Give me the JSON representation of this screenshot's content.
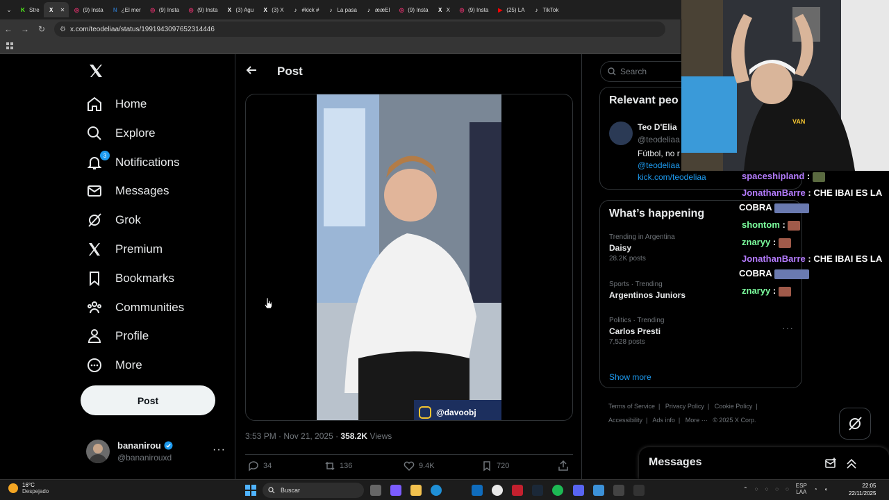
{
  "browser": {
    "tabs": [
      {
        "label": "Stre",
        "icon_color": "#53fc18",
        "icon": "K"
      },
      {
        "label": "",
        "icon_color": "#ffffff",
        "icon": "X",
        "active": true
      },
      {
        "label": "(9) Insta",
        "icon_color": "#e1306c",
        "icon": "◎"
      },
      {
        "label": "¿El mer",
        "icon_color": "#2b6cb0",
        "icon": "N"
      },
      {
        "label": "(9) Insta",
        "icon_color": "#e1306c",
        "icon": "◎"
      },
      {
        "label": "(9) Insta",
        "icon_color": "#e1306c",
        "icon": "◎"
      },
      {
        "label": "(3) Agu",
        "icon_color": "#ffffff",
        "icon": "X"
      },
      {
        "label": "(3) X",
        "icon_color": "#ffffff",
        "icon": "X"
      },
      {
        "label": "#kick #",
        "icon_color": "#ffffff",
        "icon": "♪"
      },
      {
        "label": "La pasa",
        "icon_color": "#ffffff",
        "icon": "♪"
      },
      {
        "label": "ææEl",
        "icon_color": "#ffffff",
        "icon": "♪"
      },
      {
        "label": "(9) Insta",
        "icon_color": "#e1306c",
        "icon": "◎"
      },
      {
        "label": "X",
        "icon_color": "#ffffff",
        "icon": "X"
      },
      {
        "label": "(9) Insta",
        "icon_color": "#e1306c",
        "icon": "◎"
      },
      {
        "label": "(25) LA",
        "icon_color": "#ff0000",
        "icon": "▶"
      },
      {
        "label": "TikTok",
        "icon_color": "#ffffff",
        "icon": "♪"
      }
    ],
    "url": "x.com/teodeliaa/status/1991943097652314446"
  },
  "nav": {
    "items": [
      {
        "label": "Home",
        "icon": "home-icon"
      },
      {
        "label": "Explore",
        "icon": "search-icon"
      },
      {
        "label": "Notifications",
        "icon": "bell-icon",
        "badge": "3"
      },
      {
        "label": "Messages",
        "icon": "envelope-icon"
      },
      {
        "label": "Grok",
        "icon": "grok-icon"
      },
      {
        "label": "Premium",
        "icon": "x-icon"
      },
      {
        "label": "Bookmarks",
        "icon": "bookmark-icon"
      },
      {
        "label": "Communities",
        "icon": "people-icon"
      },
      {
        "label": "Profile",
        "icon": "person-icon"
      },
      {
        "label": "More",
        "icon": "more-circle-icon"
      }
    ],
    "post_button": "Post",
    "account": {
      "name": "bananirou",
      "handle": "@bananirouxd"
    }
  },
  "post": {
    "header_title": "Post",
    "video_watermark": "@davoobj",
    "timestamp": "3:53 PM · Nov 21, 2025 · ",
    "views_count": "358.2K",
    "views_label": " Views",
    "actions": {
      "replies": "34",
      "reposts": "136",
      "likes": "9.4K",
      "bookmarks": "720"
    }
  },
  "sidebar": {
    "search_placeholder": "Search",
    "relevant": {
      "title": "Relevant peo",
      "name": "Teo D'Elia",
      "handle": "@teodeliaa",
      "bio": "Fútbol, no r",
      "link1": "@teodeliaa",
      "link2": "kick.com/teodeliaa"
    },
    "happening": {
      "title": "What’s happening",
      "trends": [
        {
          "context": "Trending in Argentina",
          "title": "Daisy",
          "posts": "28.2K posts"
        },
        {
          "context": "Sports · Trending",
          "title": "Argentinos Juniors",
          "posts": ""
        },
        {
          "context": "Politics · Trending",
          "title": "Carlos Presti",
          "posts": "7,528 posts"
        }
      ],
      "show_more": "Show more"
    },
    "footer": [
      "Terms of Service",
      "|",
      "Privacy Policy",
      "|",
      "Cookie Policy",
      "|",
      "Accessibility",
      "|",
      "Ads info",
      "|",
      "More ···",
      "© 2025 X Corp."
    ]
  },
  "messages_drawer": {
    "title": "Messages"
  },
  "stream_overlay": {
    "chat": [
      {
        "user": "spaceshipland",
        "text": ""
      },
      {
        "user": "JonathanBarre",
        "text": "CHE IBAI ES LA"
      },
      {
        "user": "",
        "text": "COBRA"
      },
      {
        "user": "shontom",
        "text": ""
      },
      {
        "user": "znaryy",
        "text": ""
      },
      {
        "user": "JonathanBarre",
        "text": "CHE IBAI ES LA"
      },
      {
        "user": "",
        "text": "COBRA"
      },
      {
        "user": "znaryy",
        "text": ""
      }
    ]
  },
  "taskbar": {
    "weather_temp": "16°C",
    "weather_desc": "Despejado",
    "search_label": "Buscar",
    "lang1": "ESP",
    "lang2": "LAA",
    "time": "22:05",
    "date": "22/11/2025"
  },
  "colors": {
    "accent": "#1d9bf0",
    "background": "#000000",
    "border": "#2f3336"
  }
}
